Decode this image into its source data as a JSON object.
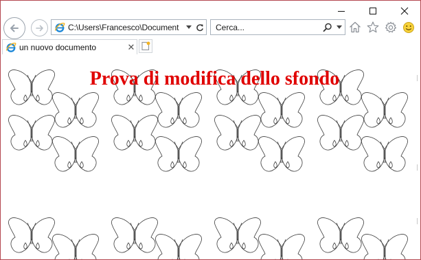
{
  "window": {
    "caption_buttons": [
      "minimize",
      "maximize",
      "close"
    ]
  },
  "nav": {
    "back_icon": "back-arrow-icon",
    "forward_icon": "forward-arrow-icon"
  },
  "address_bar": {
    "url": "C:\\Users\\Francesco\\Document",
    "icons": [
      "ie-page-icon",
      "dropdown-icon",
      "refresh-icon"
    ]
  },
  "search_bar": {
    "placeholder": "Cerca...",
    "icons": [
      "search-icon",
      "dropdown-icon"
    ]
  },
  "toolbar_icons": [
    "home-icon",
    "favorites-star-icon",
    "settings-gear-icon",
    "smiley-feedback-icon"
  ],
  "tabs": [
    {
      "label": "un nuovo documento",
      "active": true
    }
  ],
  "page": {
    "heading": "Prova di modifica dello sfondo",
    "heading_color": "#e00000",
    "background_pattern": "butterfly-outline-tile"
  },
  "colors": {
    "window_border": "#b4474f",
    "ie_blue": "#1e88d8",
    "ie_gold": "#f3b320"
  }
}
